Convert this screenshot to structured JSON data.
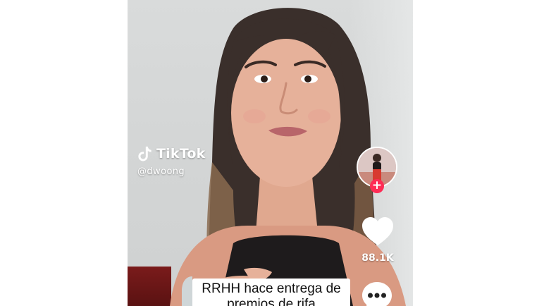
{
  "watermark": {
    "brand": "TikTok",
    "username": "@dwoong",
    "logo_icon": "tiktok-logo-icon"
  },
  "actions": {
    "avatar_icon": "creator-avatar",
    "follow_icon": "plus-icon",
    "follow_label": "+",
    "like_icon": "heart-icon",
    "like_count": "88.1K",
    "comment_icon": "ellipsis-icon"
  },
  "caption": {
    "line1": "RRHH hace entrega de",
    "line2": "premios de rifa"
  },
  "colors": {
    "follow_accent": "#fe2c55",
    "like_heart": "#ffffff",
    "background": "#ffffff"
  }
}
